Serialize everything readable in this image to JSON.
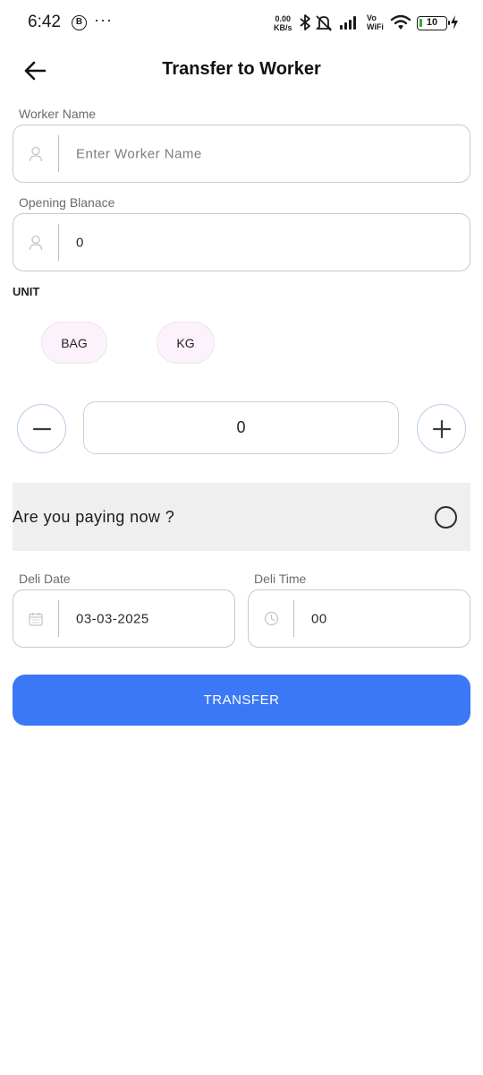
{
  "status_bar": {
    "time": "6:42",
    "b_badge": "B",
    "more": "···",
    "speed_value": "0.00",
    "speed_unit": "KB/s",
    "vo": "Vo",
    "wifi_label": "WiFi",
    "battery": "10"
  },
  "header": {
    "title": "Transfer to Worker"
  },
  "worker_name": {
    "label": "Worker Name",
    "placeholder": "Enter Worker Name",
    "value": ""
  },
  "opening_balance": {
    "label": "Opening Blanace",
    "value": "0"
  },
  "unit": {
    "label": "UNIT",
    "options": [
      "BAG",
      "KG"
    ]
  },
  "quantity": {
    "value": "0"
  },
  "paying": {
    "question": "Are you paying now ?",
    "selected": false
  },
  "deli_date": {
    "label": "Deli Date",
    "value": "03-03-2025"
  },
  "deli_time": {
    "label": "Deli Time",
    "value": "00"
  },
  "actions": {
    "transfer_label": "TRANSFER"
  },
  "colors": {
    "primary": "#3b78f7",
    "chip_bg": "#fbf2fb",
    "row_bg": "#efefef"
  }
}
